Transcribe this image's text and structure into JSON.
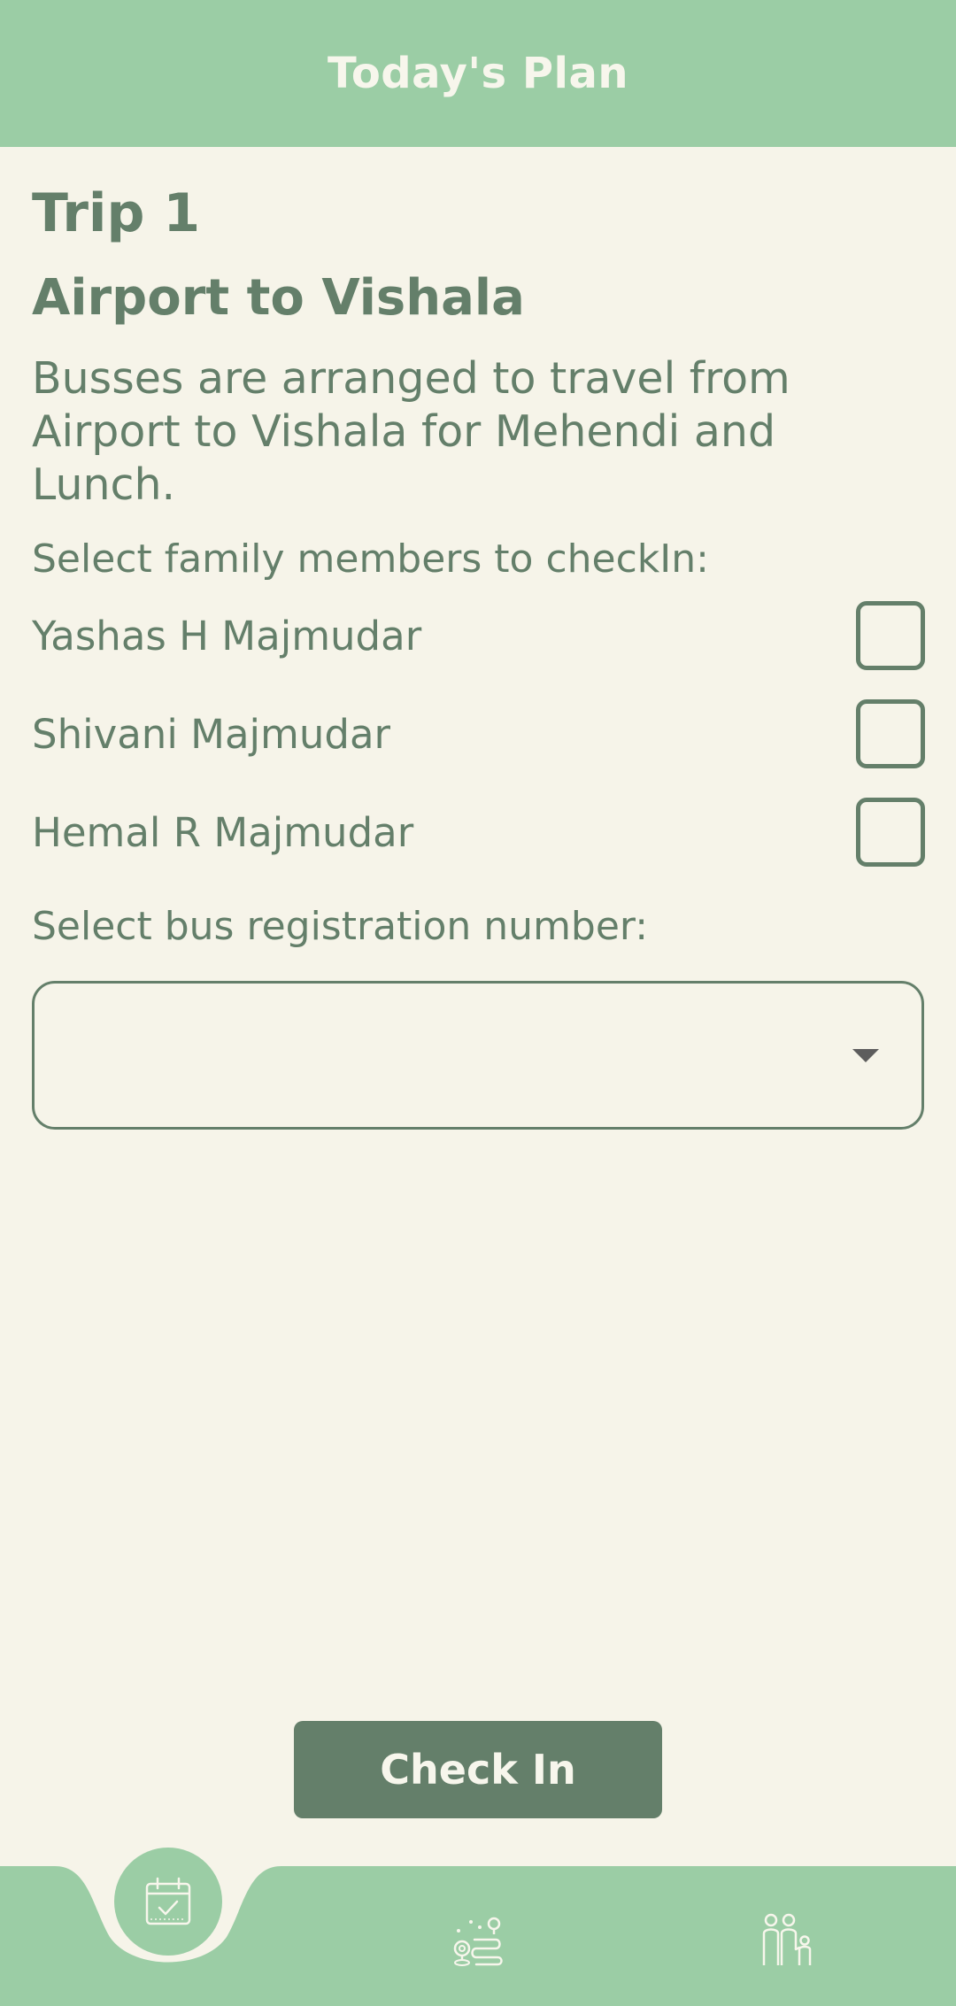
{
  "header": {
    "title": "Today's Plan"
  },
  "trip": {
    "title": "Trip 1",
    "route": "Airport to Vishala",
    "description": "Busses are arranged to travel from Airport to Vishala for Mehendi and Lunch."
  },
  "members": {
    "prompt": "Select family members to checkIn:",
    "items": [
      {
        "name": "Yashas H Majmudar",
        "checked": false
      },
      {
        "name": "Shivani Majmudar",
        "checked": false
      },
      {
        "name": "Hemal R Majmudar",
        "checked": false
      }
    ]
  },
  "bus": {
    "prompt": "Select bus registration number:",
    "selected_value": ""
  },
  "actions": {
    "checkin_label": "Check In"
  },
  "nav": {
    "items": [
      {
        "icon": "calendar-check-icon",
        "active": true
      },
      {
        "icon": "route-map-icon",
        "active": false
      },
      {
        "icon": "family-icon",
        "active": false
      }
    ]
  },
  "colors": {
    "header_bg": "#9BCDA5",
    "page_bg": "#F6F4E9",
    "primary_text": "#647F6A",
    "button_bg": "#647F6A",
    "light_text": "#F7F6EC"
  }
}
